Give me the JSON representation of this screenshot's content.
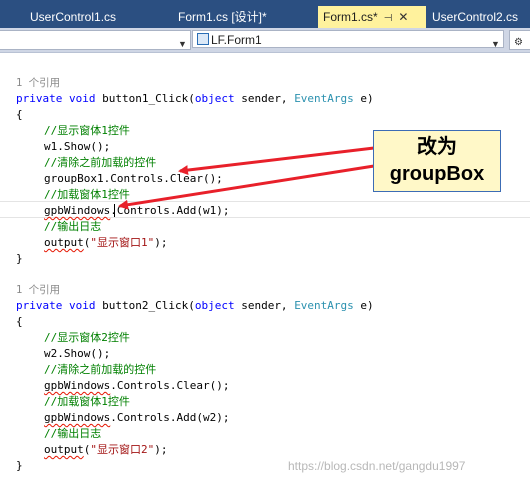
{
  "tabs": [
    {
      "label": "UserControl1.cs",
      "active": false
    },
    {
      "label": "Form1.cs [设计]*",
      "active": false
    },
    {
      "label": "Form1.cs*",
      "active": true,
      "pin": "⊣",
      "close": "✕"
    },
    {
      "label": "UserControl2.cs",
      "active": false
    }
  ],
  "nav": {
    "member_dropdown": "LF.Form1"
  },
  "code": {
    "lens1": "1 个引用",
    "m1_private": "private",
    "m1_void": "void",
    "m1_name": "button1_Click(",
    "m1_object": "object",
    "m1_sender": " sender, ",
    "m1_eventargs": "EventArgs",
    "m1_e": " e)",
    "open1": "{",
    "c1": "//显示窗体1控件",
    "s1": "w1.Show();",
    "c2": "//清除之前加载的控件",
    "s2": "groupBox1.Controls.Clear();",
    "c3": "//加载窗体1控件",
    "s3_var": "gpbWindows",
    "s3_rest": ".Controls.Add(w1);",
    "c4": "//输出日志",
    "s4_call": "output",
    "s4_paren_open": "(",
    "s4_str": "\"显示窗口1\"",
    "s4_paren_close": ");",
    "close1": "}",
    "lens2": "1 个引用",
    "m2_name": "button2_Click(",
    "open2": "{",
    "c5": "//显示窗体2控件",
    "s5": "w2.Show();",
    "c6": "//清除之前加载的控件",
    "s6_var": "gpbWindows",
    "s6_rest": ".Controls.Clear();",
    "c7": "//加载窗体1控件",
    "s7_var": "gpbWindows",
    "s7_rest": ".Controls.Add(w2);",
    "c8": "//输出日志",
    "s8_call": "output",
    "s8_str": "\"显示窗口2\"",
    "close2": "}"
  },
  "callout": {
    "line1": "改为",
    "line2": "groupBox"
  },
  "watermark": "https://blog.csdn.net/gangdu1997",
  "colors": {
    "keyword": "#0000ff",
    "type": "#2b91af",
    "comment": "#008000",
    "string": "#a31515",
    "arrow": "#e8202a",
    "tabbar": "#2b4f81",
    "active_tab": "#fff29d"
  }
}
